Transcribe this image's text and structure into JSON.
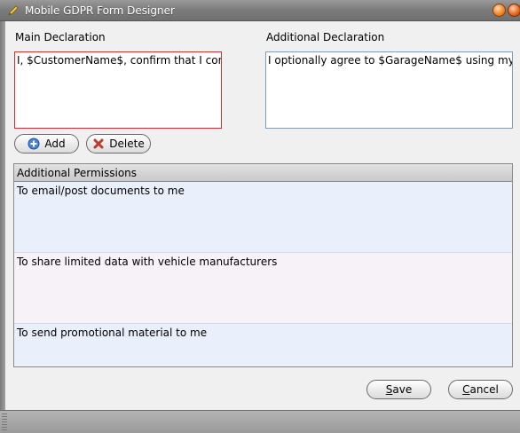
{
  "window": {
    "title": "Mobile GDPR Form Designer",
    "icon": "pencil-icon"
  },
  "main_declaration": {
    "label": "Main Declaration",
    "value": "I, $CustomerName$, confirm that I consent"
  },
  "additional_declaration": {
    "label": "Additional Declaration",
    "value": "I optionally agree to $GarageName$ using my personal"
  },
  "buttons": {
    "add_label": "Add",
    "delete_label": "Delete",
    "save_label": "Save",
    "cancel_label": "Cancel"
  },
  "permissions": {
    "header": "Additional Permissions",
    "rows": [
      "To email/post documents to me",
      "To share limited data with vehicle manufacturers",
      "To send promotional material to me"
    ]
  },
  "colors": {
    "invalid_border": "#d03030",
    "row_odd": "#eaf0fb",
    "row_even": "#f7f1f8"
  }
}
